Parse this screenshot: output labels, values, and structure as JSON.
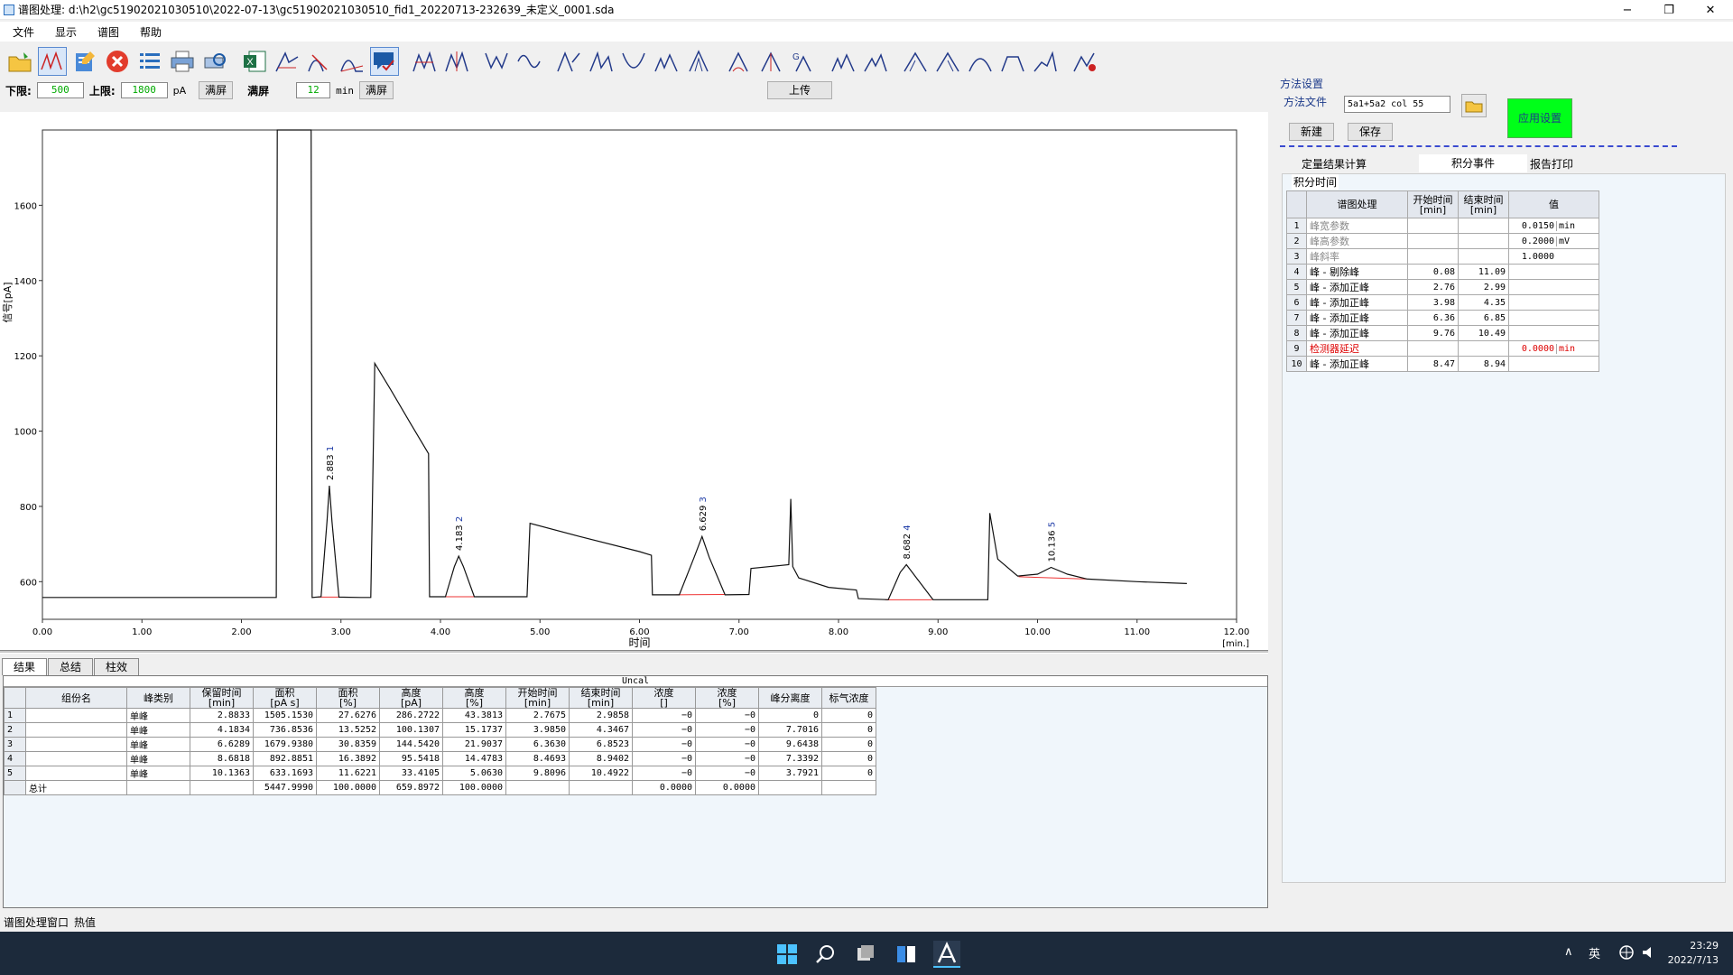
{
  "window": {
    "title": "谱图处理: d:\\h2\\gc51902021030510\\2022-07-13\\gc51902021030510_fid1_20220713-232639_未定义_0001.sda",
    "min": "−",
    "max": "❐",
    "close": "✕"
  },
  "menu": [
    "文件",
    "显示",
    "谱图",
    "帮助"
  ],
  "limits": {
    "lower_label": "下限:",
    "lower_value": "500",
    "upper_label": "上限:",
    "upper_value": "1800",
    "unit": "pA",
    "full1": "满屏",
    "full_label": "满屏",
    "time_value": "12",
    "time_unit": "min",
    "full2": "满屏",
    "upload": "上传"
  },
  "method": {
    "section": "方法设置",
    "file_label": "方法文件",
    "file_value": "5a1+5a2 col 55",
    "new": "新建",
    "save": "保存",
    "apply": "应用设置",
    "tabs": [
      "定量结果计算",
      "积分事件",
      "报告打印"
    ],
    "group": "积分时间",
    "headers": [
      "谱图处理",
      "开始时间\n[min]",
      "结束时间\n[min]",
      "值"
    ],
    "rows": [
      {
        "i": "1",
        "name": "峰宽参数",
        "start": "",
        "end": "",
        "val": "0.0150",
        "unit": "min",
        "gray": true
      },
      {
        "i": "2",
        "name": "峰高参数",
        "start": "",
        "end": "",
        "val": "0.2000",
        "unit": "mV",
        "gray": true
      },
      {
        "i": "3",
        "name": "峰斜率",
        "start": "",
        "end": "",
        "val": "1.0000",
        "unit": "",
        "gray": true
      },
      {
        "i": "4",
        "name": "峰 - 剔除峰",
        "start": "0.08",
        "end": "11.09",
        "val": "",
        "unit": ""
      },
      {
        "i": "5",
        "name": "峰 - 添加正峰",
        "start": "2.76",
        "end": "2.99",
        "val": "",
        "unit": ""
      },
      {
        "i": "6",
        "name": "峰 - 添加正峰",
        "start": "3.98",
        "end": "4.35",
        "val": "",
        "unit": ""
      },
      {
        "i": "7",
        "name": "峰 - 添加正峰",
        "start": "6.36",
        "end": "6.85",
        "val": "",
        "unit": ""
      },
      {
        "i": "8",
        "name": "峰 - 添加正峰",
        "start": "9.76",
        "end": "10.49",
        "val": "",
        "unit": ""
      },
      {
        "i": "9",
        "name": "检测器延迟",
        "start": "",
        "end": "",
        "val": "0.0000",
        "unit": "min",
        "red": true
      },
      {
        "i": "10",
        "name": "峰 - 添加正峰",
        "start": "8.47",
        "end": "8.94",
        "val": "",
        "unit": ""
      }
    ]
  },
  "result_tabs": [
    "结果",
    "总结",
    "柱效"
  ],
  "results": {
    "caption": "Uncal",
    "headers": [
      "组份名",
      "峰类别",
      "保留时间\n[min]",
      "面积\n[pA s]",
      "面积\n[%]",
      "高度\n[pA]",
      "高度\n[%]",
      "开始时间\n[min]",
      "结束时间\n[min]",
      "浓度\n[]",
      "浓度\n[%]",
      "峰分离度",
      "标气浓度"
    ],
    "rows": [
      [
        "1",
        "",
        "单峰",
        "2.8833",
        "1505.1530",
        "27.6276",
        "286.2722",
        "43.3813",
        "2.7675",
        "2.9858",
        "−0",
        "−0",
        "0",
        "0"
      ],
      [
        "2",
        "",
        "单峰",
        "4.1834",
        "736.8536",
        "13.5252",
        "100.1307",
        "15.1737",
        "3.9850",
        "4.3467",
        "−0",
        "−0",
        "7.7016",
        "0"
      ],
      [
        "3",
        "",
        "单峰",
        "6.6289",
        "1679.9380",
        "30.8359",
        "144.5420",
        "21.9037",
        "6.3630",
        "6.8523",
        "−0",
        "−0",
        "9.6438",
        "0"
      ],
      [
        "4",
        "",
        "单峰",
        "8.6818",
        "892.8851",
        "16.3892",
        "95.5418",
        "14.4783",
        "8.4693",
        "8.9402",
        "−0",
        "−0",
        "7.3392",
        "0"
      ],
      [
        "5",
        "",
        "单峰",
        "10.1363",
        "633.1693",
        "11.6221",
        "33.4105",
        "5.0630",
        "9.8096",
        "10.4922",
        "−0",
        "−0",
        "3.7921",
        "0"
      ]
    ],
    "total": [
      "",
      "总计",
      "",
      "",
      "5447.9990",
      "100.0000",
      "659.8972",
      "100.0000",
      "",
      "",
      "0.0000",
      "0.0000",
      "",
      ""
    ]
  },
  "status": {
    "text": "谱图处理窗口",
    "hot": "热值"
  },
  "taskbar": {
    "ime": "英",
    "time": "23:29",
    "date": "2022/7/13",
    "caret": "∧"
  },
  "chart_data": {
    "type": "line",
    "xlabel": "时间",
    "xunit": "[min.]",
    "ylabel": "信号[pA]",
    "xlim": [
      0,
      12
    ],
    "ylim": [
      500,
      1800
    ],
    "xticks": [
      "0.00",
      "1.00",
      "2.00",
      "3.00",
      "4.00",
      "5.00",
      "6.00",
      "7.00",
      "8.00",
      "9.00",
      "10.00",
      "11.00",
      "12.00"
    ],
    "yticks": [
      600,
      800,
      1000,
      1200,
      1400,
      1600
    ],
    "peaks": [
      {
        "rt": 2.883,
        "label": "2.883",
        "num": "1",
        "apex": 855
      },
      {
        "rt": 4.183,
        "label": "4.183",
        "num": "2",
        "apex": 668
      },
      {
        "rt": 6.629,
        "label": "6.629",
        "num": "3",
        "apex": 720
      },
      {
        "rt": 8.682,
        "label": "8.682",
        "num": "4",
        "apex": 645
      },
      {
        "rt": 10.136,
        "label": "10.136",
        "num": "5",
        "apex": 638
      }
    ],
    "trace": [
      [
        0,
        558
      ],
      [
        2.35,
        558
      ],
      [
        2.36,
        1800
      ],
      [
        2.37,
        1800
      ],
      [
        2.7,
        1800
      ],
      [
        2.71,
        558
      ],
      [
        2.8,
        560
      ],
      [
        2.86,
        760
      ],
      [
        2.883,
        855
      ],
      [
        2.91,
        760
      ],
      [
        2.98,
        559
      ],
      [
        3.2,
        558
      ],
      [
        3.3,
        558
      ],
      [
        3.34,
        1180
      ],
      [
        3.5,
        1110
      ],
      [
        3.7,
        1020
      ],
      [
        3.88,
        940
      ],
      [
        3.89,
        560
      ],
      [
        4.05,
        560
      ],
      [
        4.14,
        640
      ],
      [
        4.183,
        668
      ],
      [
        4.23,
        640
      ],
      [
        4.34,
        560
      ],
      [
        4.75,
        560
      ],
      [
        4.87,
        560
      ],
      [
        4.9,
        755
      ],
      [
        5.4,
        720
      ],
      [
        6.0,
        680
      ],
      [
        6.12,
        670
      ],
      [
        6.13,
        565
      ],
      [
        6.4,
        565
      ],
      [
        6.55,
        665
      ],
      [
        6.629,
        720
      ],
      [
        6.7,
        665
      ],
      [
        6.86,
        565
      ],
      [
        7.1,
        566
      ],
      [
        7.12,
        635
      ],
      [
        7.5,
        645
      ],
      [
        7.52,
        820
      ],
      [
        7.54,
        640
      ],
      [
        7.6,
        610
      ],
      [
        7.9,
        585
      ],
      [
        8.18,
        578
      ],
      [
        8.2,
        555
      ],
      [
        8.5,
        552
      ],
      [
        8.62,
        625
      ],
      [
        8.682,
        645
      ],
      [
        8.74,
        625
      ],
      [
        8.95,
        552
      ],
      [
        9.5,
        552
      ],
      [
        9.52,
        782
      ],
      [
        9.6,
        660
      ],
      [
        9.8,
        615
      ],
      [
        10.0,
        620
      ],
      [
        10.136,
        638
      ],
      [
        10.3,
        620
      ],
      [
        10.5,
        607
      ],
      [
        11.0,
        600
      ],
      [
        11.5,
        595
      ]
    ]
  }
}
